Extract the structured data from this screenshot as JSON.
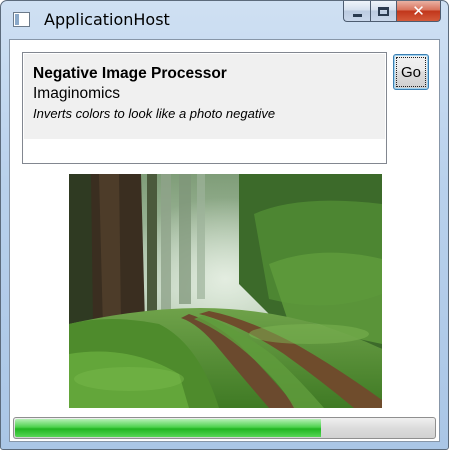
{
  "window": {
    "title": "ApplicationHost"
  },
  "icons": {
    "app": "app-window-icon",
    "minimize": "minimize-icon",
    "maximize": "maximize-icon",
    "close": "close-icon"
  },
  "plugin": {
    "name": "Negative Image Processor",
    "author": "Imaginomics",
    "description": "Inverts colors to look like a photo negative"
  },
  "go_button": {
    "label": "Go"
  },
  "image": {
    "subject": "forest path photo"
  },
  "progress": {
    "fraction": 0.73
  },
  "colors": {
    "progress_fill": "#22b522",
    "close_button": "#c1361b",
    "focus_border": "#3c7fb1"
  }
}
